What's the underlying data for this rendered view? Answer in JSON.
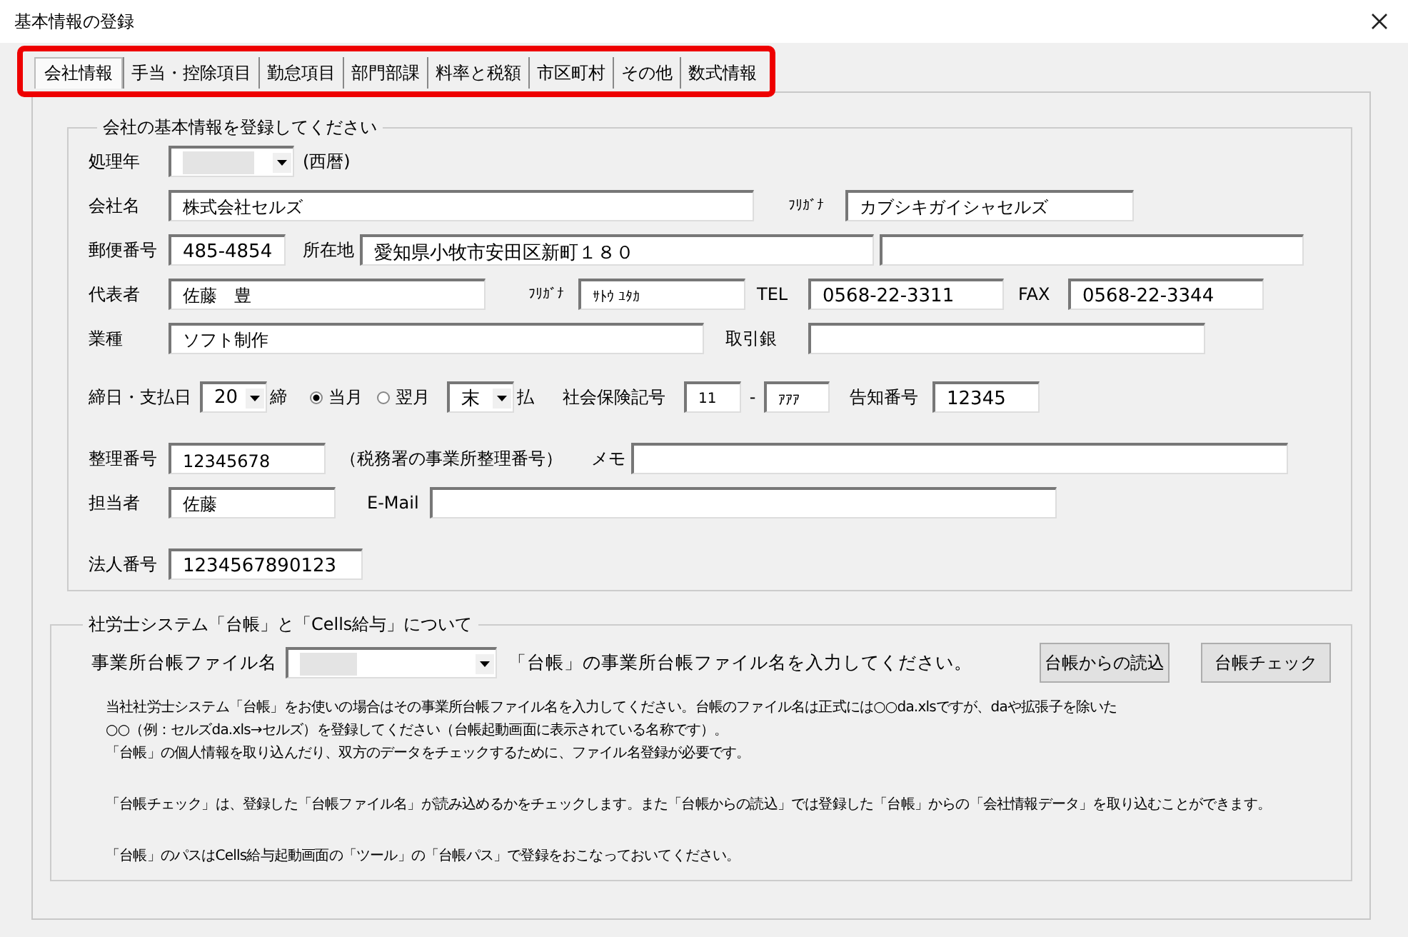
{
  "window": {
    "title": "基本情報の登録"
  },
  "tabs": [
    {
      "label": "会社情報",
      "selected": true
    },
    {
      "label": "手当・控除項目",
      "selected": false
    },
    {
      "label": "勤怠項目",
      "selected": false
    },
    {
      "label": "部門部課",
      "selected": false
    },
    {
      "label": "料率と税額",
      "selected": false
    },
    {
      "label": "市区町村",
      "selected": false
    },
    {
      "label": "その他",
      "selected": false
    },
    {
      "label": "数式情報",
      "selected": false
    }
  ],
  "company_group": {
    "title": "会社の基本情報を登録してください",
    "year": {
      "label": "処理年",
      "note": "(西暦)"
    },
    "company_name": {
      "label": "会社名",
      "value": "株式会社セルズ"
    },
    "company_kana": {
      "label": "ﾌﾘｶﾞﾅ",
      "value": "カブシキガイシャセルズ"
    },
    "postal_code": {
      "label": "郵便番号",
      "value": "485-4854"
    },
    "address": {
      "label": "所在地",
      "value": "愛知県小牧市安田区新町１８０"
    },
    "representative": {
      "label": "代表者",
      "value": "佐藤　豊"
    },
    "representative_kana": {
      "label": "ﾌﾘｶﾞﾅ",
      "value": "ｻﾄｳ ﾕﾀｶ"
    },
    "tel": {
      "label": "TEL",
      "value": "0568-22-3311"
    },
    "fax": {
      "label": "FAX",
      "value": "0568-22-3344"
    },
    "industry": {
      "label": "業種",
      "value": "ソフト制作"
    },
    "bank": {
      "label": "取引銀"
    },
    "closing": {
      "label": "締日・支払日",
      "closing_day": "20",
      "closing_suffix": "締",
      "pay_day": "末",
      "pay_suffix": "払"
    },
    "pay_month": [
      {
        "label": "当月",
        "selected": true
      },
      {
        "label": "翌月",
        "selected": false
      }
    ],
    "insurance": {
      "label": "社会保険記号",
      "part_1": "11",
      "separator": "-",
      "part_2": "ｱｱｱ"
    },
    "notice_number": {
      "label": "告知番号",
      "value": "12345"
    },
    "reference_number": {
      "label": "整理番号",
      "value": "12345678",
      "note": "（税務署の事業所整理番号）"
    },
    "memo": {
      "label": "メモ"
    },
    "staff": {
      "label": "担当者",
      "value": "佐藤"
    },
    "email": {
      "label": "E-Mail"
    },
    "corporate_number": {
      "label": "法人番号",
      "value": "1234567890123"
    }
  },
  "ledger_group": {
    "title": "社労士システム「台帳」と「Cells給与」について",
    "file": {
      "label": "事業所台帳ファイル名",
      "hint": "「台帳」の事業所台帳ファイル名を入力してください。"
    },
    "buttons": [
      "台帳からの読込",
      "台帳チェック"
    ],
    "paragraphs": [
      [
        "当社社労士システム「台帳」をお使いの場合はその事業所台帳ファイル名を入力してください。台帳のファイル名は正式には○○da.xlsですが、daや拡張子を除いた",
        "○○（例：セルズda.xls→セルズ）を登録してください（台帳起動画面に表示されている名称です）。",
        "「台帳」の個人情報を取り込んだり、双方のデータをチェックするために、ファイル名登録が必要です。"
      ],
      [
        "「台帳チェック」は、登録した「台帳ファイル名」が読み込めるかをチェックします。また「台帳からの読込」では登録した「台帳」からの「会社情報データ」を取り込むことができます。"
      ],
      [
        "「台帳」のパスはCells給与起動画面の「ツール」の「台帳パス」で登録をおこなっておいてください。"
      ]
    ]
  }
}
